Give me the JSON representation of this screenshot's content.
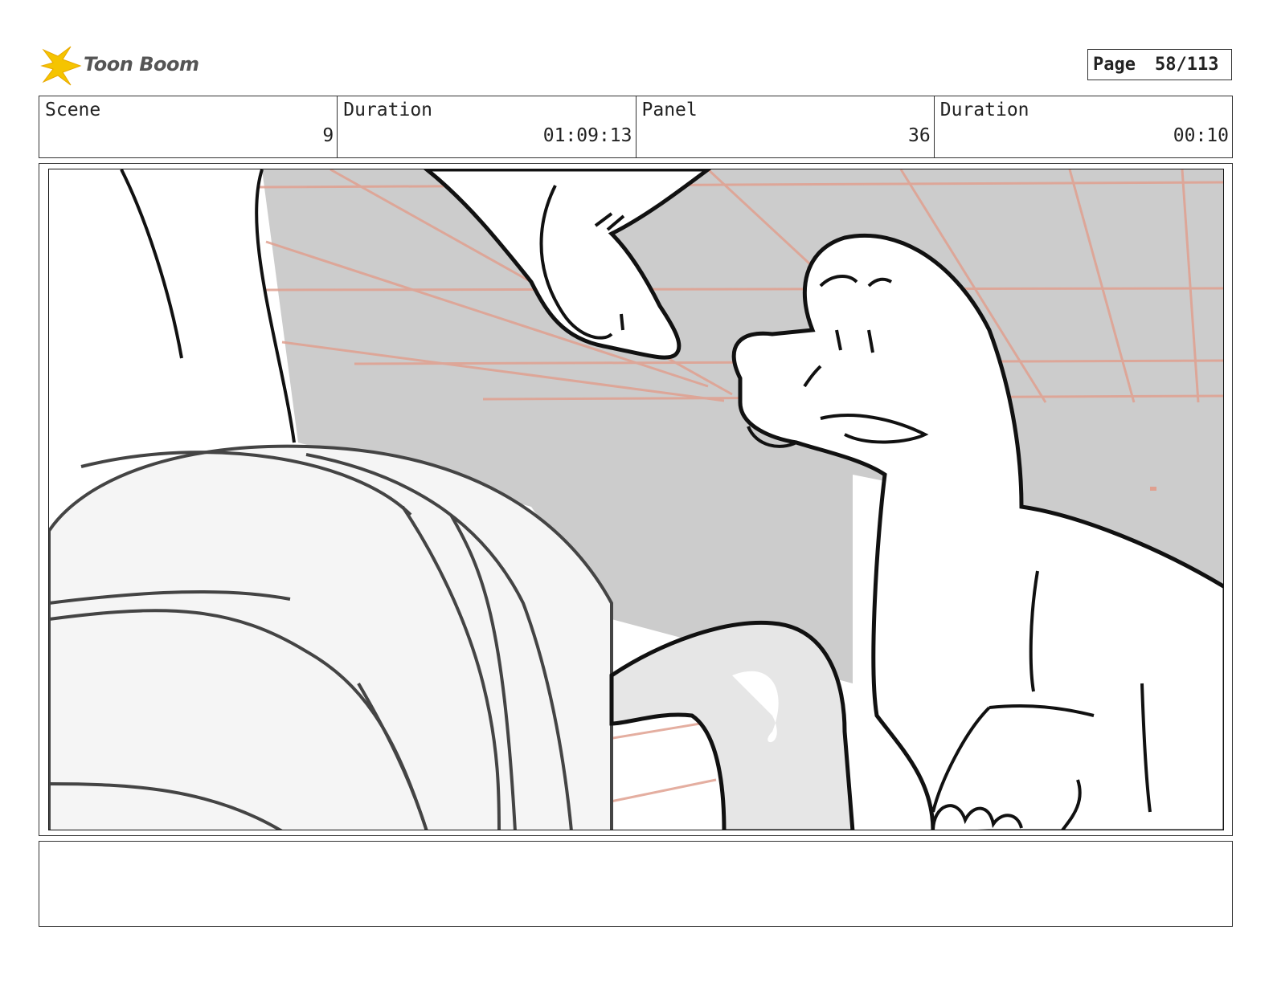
{
  "header": {
    "logo_text": "Toon Boom",
    "page_label": "Page",
    "page_value": "58/113"
  },
  "info": {
    "scene_label": "Scene",
    "scene_value": "9",
    "scene_duration_label": "Duration",
    "scene_duration_value": "01:09:13",
    "panel_label": "Panel",
    "panel_value": "36",
    "panel_duration_label": "Duration",
    "panel_duration_value": "00:10"
  },
  "colors": {
    "logo_accent": "#f5c400",
    "background_gray": "#cccccc",
    "guide_lines": "#e0a090",
    "foreground_light": "#f5f5f5"
  },
  "notes": {
    "text": ""
  }
}
